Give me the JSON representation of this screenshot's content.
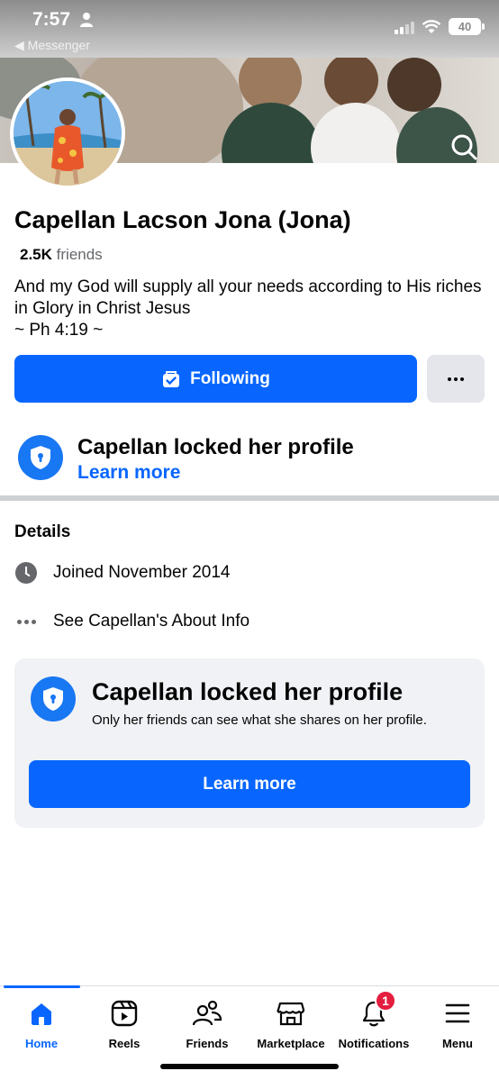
{
  "status_bar": {
    "time": "7:57",
    "back_app": "◀ Messenger",
    "battery": "40"
  },
  "profile": {
    "name": "Capellan Lacson Jona (Jona)",
    "friends_count": "2.5K",
    "friends_label": "friends",
    "bio": "And my God will supply all your needs according to His riches in Glory in Christ Jesus\n~   Ph 4:19 ~"
  },
  "actions": {
    "following_label": "Following",
    "more_label": "..."
  },
  "lock_notice": {
    "title": "Capellan locked her profile",
    "link": "Learn more"
  },
  "details": {
    "title": "Details",
    "joined": "Joined November 2014",
    "about": "See Capellan's About Info"
  },
  "lock_card": {
    "title": "Capellan locked her profile",
    "description": "Only her friends can see what she shares on her profile.",
    "button": "Learn more"
  },
  "tabs": [
    {
      "label": "Home",
      "icon": "home-icon",
      "active": true
    },
    {
      "label": "Reels",
      "icon": "reels-icon"
    },
    {
      "label": "Friends",
      "icon": "friends-icon"
    },
    {
      "label": "Marketplace",
      "icon": "marketplace-icon"
    },
    {
      "label": "Notifications",
      "icon": "bell-icon",
      "badge": "1"
    },
    {
      "label": "Menu",
      "icon": "menu-icon"
    }
  ],
  "colors": {
    "accent": "#0866ff",
    "badge": "#e41e3f",
    "secondary_button": "#e4e6eb",
    "card_bg": "#f0f2f5"
  }
}
